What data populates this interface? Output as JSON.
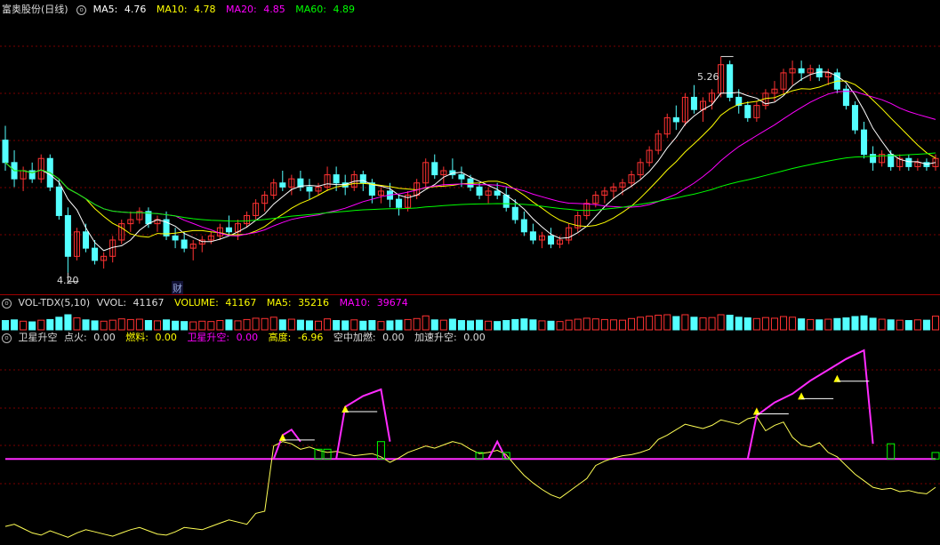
{
  "colors": {
    "up": "#ff3232",
    "down": "#54ffff",
    "ma5": "#ffffff",
    "ma10": "#ffff00",
    "ma20": "#ff00ff",
    "ma60": "#00ff00",
    "grid": "#7a0000",
    "magenta": "#ff2bff",
    "yellowLine": "#ffff55",
    "green": "#00ff00",
    "vol_up": "#ff3232",
    "vol_down": "#54ffff"
  },
  "price_panel": {
    "title": "富奥股份(日线)",
    "icon": "circle-icon",
    "ma5_label": "MA5:",
    "ma5_value": "4.76",
    "ma10_label": "MA10:",
    "ma10_value": "4.78",
    "ma20_label": "MA20:",
    "ma20_value": "4.85",
    "ma60_label": "MA60:",
    "ma60_value": "4.89",
    "high_label": "5.26",
    "low_label": "4.20",
    "marker_text": "财"
  },
  "vol_panel": {
    "title": "VOL-TDX(5,10)",
    "vvol_label": "VVOL:",
    "vvol_value": "41167",
    "volume_label": "VOLUME:",
    "volume_value": "41167",
    "ma5_label": "MA5:",
    "ma5_value": "35216",
    "ma10_label": "MA10:",
    "ma10_value": "39674"
  },
  "ind_panel": {
    "title": "卫星升空",
    "dianhuo_label": "点火:",
    "dianhuo_value": "0.00",
    "ranliao_label": "燃料:",
    "ranliao_value": "0.00",
    "weixing_label": "卫星升空:",
    "weixing_value": "0.00",
    "gaodu_label": "高度:",
    "gaodu_value": "-6.96",
    "kongzhong_label": "空中加燃:",
    "kongzhong_value": "0.00",
    "jiasu_label": "加速升空:",
    "jiasu_value": "0.00"
  },
  "chart_data": {
    "type": "candlestick",
    "price_range": [
      4.12,
      5.45
    ],
    "ma_names": [
      "MA5",
      "MA10",
      "MA20",
      "MA60"
    ],
    "candles": [
      [
        4.85,
        4.92,
        4.7,
        4.74
      ],
      [
        4.74,
        4.8,
        4.62,
        4.66
      ],
      [
        4.66,
        4.72,
        4.6,
        4.7
      ],
      [
        4.7,
        4.74,
        4.64,
        4.66
      ],
      [
        4.66,
        4.78,
        4.64,
        4.76
      ],
      [
        4.76,
        4.78,
        4.6,
        4.62
      ],
      [
        4.62,
        4.66,
        4.46,
        4.48
      ],
      [
        4.48,
        4.52,
        4.2,
        4.28
      ],
      [
        4.28,
        4.42,
        4.26,
        4.4
      ],
      [
        4.4,
        4.44,
        4.3,
        4.32
      ],
      [
        4.32,
        4.36,
        4.24,
        4.26
      ],
      [
        4.26,
        4.3,
        4.22,
        4.28
      ],
      [
        4.28,
        4.38,
        4.25,
        4.36
      ],
      [
        4.36,
        4.46,
        4.34,
        4.44
      ],
      [
        4.44,
        4.5,
        4.4,
        4.46
      ],
      [
        4.46,
        4.52,
        4.44,
        4.5
      ],
      [
        4.5,
        4.52,
        4.42,
        4.44
      ],
      [
        4.44,
        4.48,
        4.4,
        4.46
      ],
      [
        4.46,
        4.5,
        4.36,
        4.38
      ],
      [
        4.38,
        4.42,
        4.32,
        4.36
      ],
      [
        4.36,
        4.4,
        4.3,
        4.32
      ],
      [
        4.32,
        4.36,
        4.26,
        4.34
      ],
      [
        4.34,
        4.38,
        4.3,
        4.36
      ],
      [
        4.36,
        4.4,
        4.34,
        4.38
      ],
      [
        4.38,
        4.44,
        4.36,
        4.42
      ],
      [
        4.42,
        4.48,
        4.38,
        4.4
      ],
      [
        4.4,
        4.46,
        4.36,
        4.44
      ],
      [
        4.44,
        4.5,
        4.42,
        4.48
      ],
      [
        4.48,
        4.56,
        4.46,
        4.54
      ],
      [
        4.54,
        4.6,
        4.5,
        4.58
      ],
      [
        4.58,
        4.66,
        4.56,
        4.64
      ],
      [
        4.64,
        4.7,
        4.6,
        4.62
      ],
      [
        4.62,
        4.68,
        4.58,
        4.66
      ],
      [
        4.66,
        4.7,
        4.6,
        4.62
      ],
      [
        4.62,
        4.66,
        4.56,
        4.6
      ],
      [
        4.6,
        4.64,
        4.58,
        4.62
      ],
      [
        4.62,
        4.72,
        4.6,
        4.68
      ],
      [
        4.68,
        4.72,
        4.6,
        4.64
      ],
      [
        4.64,
        4.68,
        4.58,
        4.62
      ],
      [
        4.62,
        4.7,
        4.6,
        4.68
      ],
      [
        4.68,
        4.7,
        4.6,
        4.64
      ],
      [
        4.64,
        4.66,
        4.54,
        4.58
      ],
      [
        4.58,
        4.62,
        4.54,
        4.6
      ],
      [
        4.6,
        4.64,
        4.52,
        4.56
      ],
      [
        4.56,
        4.58,
        4.48,
        4.52
      ],
      [
        4.52,
        4.6,
        4.5,
        4.58
      ],
      [
        4.58,
        4.66,
        4.56,
        4.64
      ],
      [
        4.64,
        4.76,
        4.62,
        4.74
      ],
      [
        4.74,
        4.78,
        4.66,
        4.68
      ],
      [
        4.68,
        4.72,
        4.62,
        4.7
      ],
      [
        4.7,
        4.76,
        4.66,
        4.68
      ],
      [
        4.68,
        4.72,
        4.62,
        4.66
      ],
      [
        4.66,
        4.68,
        4.6,
        4.62
      ],
      [
        4.62,
        4.64,
        4.56,
        4.58
      ],
      [
        4.58,
        4.62,
        4.54,
        4.6
      ],
      [
        4.6,
        4.64,
        4.56,
        4.58
      ],
      [
        4.58,
        4.62,
        4.5,
        4.52
      ],
      [
        4.52,
        4.56,
        4.44,
        4.46
      ],
      [
        4.46,
        4.5,
        4.38,
        4.4
      ],
      [
        4.4,
        4.44,
        4.34,
        4.36
      ],
      [
        4.36,
        4.4,
        4.32,
        4.38
      ],
      [
        4.38,
        4.42,
        4.32,
        4.34
      ],
      [
        4.34,
        4.38,
        4.32,
        4.36
      ],
      [
        4.36,
        4.44,
        4.34,
        4.42
      ],
      [
        4.42,
        4.5,
        4.4,
        4.48
      ],
      [
        4.48,
        4.56,
        4.46,
        4.54
      ],
      [
        4.54,
        4.6,
        4.52,
        4.58
      ],
      [
        4.58,
        4.62,
        4.54,
        4.6
      ],
      [
        4.6,
        4.64,
        4.56,
        4.62
      ],
      [
        4.62,
        4.66,
        4.58,
        4.64
      ],
      [
        4.64,
        4.7,
        4.62,
        4.68
      ],
      [
        4.68,
        4.76,
        4.66,
        4.74
      ],
      [
        4.74,
        4.82,
        4.72,
        4.8
      ],
      [
        4.8,
        4.9,
        4.78,
        4.88
      ],
      [
        4.88,
        4.98,
        4.86,
        4.96
      ],
      [
        4.96,
        5.02,
        4.9,
        4.94
      ],
      [
        4.94,
        5.08,
        4.92,
        5.06
      ],
      [
        5.06,
        5.12,
        4.98,
        5.0
      ],
      [
        5.0,
        5.06,
        4.94,
        5.04
      ],
      [
        5.04,
        5.1,
        5.0,
        5.08
      ],
      [
        5.08,
        5.26,
        5.06,
        5.22
      ],
      [
        5.22,
        5.24,
        5.04,
        5.06
      ],
      [
        5.06,
        5.1,
        4.98,
        5.02
      ],
      [
        5.02,
        5.04,
        4.94,
        4.96
      ],
      [
        4.96,
        5.04,
        4.94,
        5.02
      ],
      [
        5.02,
        5.1,
        5.0,
        5.08
      ],
      [
        5.08,
        5.14,
        5.04,
        5.1
      ],
      [
        5.1,
        5.2,
        5.08,
        5.18
      ],
      [
        5.18,
        5.24,
        5.12,
        5.2
      ],
      [
        5.2,
        5.24,
        5.14,
        5.18
      ],
      [
        5.18,
        5.22,
        5.14,
        5.2
      ],
      [
        5.2,
        5.22,
        5.14,
        5.16
      ],
      [
        5.16,
        5.2,
        5.12,
        5.18
      ],
      [
        5.18,
        5.2,
        5.08,
        5.1
      ],
      [
        5.1,
        5.12,
        5.0,
        5.02
      ],
      [
        5.02,
        5.04,
        4.88,
        4.9
      ],
      [
        4.9,
        4.94,
        4.76,
        4.78
      ],
      [
        4.78,
        4.82,
        4.7,
        4.74
      ],
      [
        4.74,
        4.8,
        4.72,
        4.78
      ],
      [
        4.78,
        4.8,
        4.7,
        4.72
      ],
      [
        4.72,
        4.78,
        4.7,
        4.76
      ],
      [
        4.76,
        4.78,
        4.7,
        4.72
      ],
      [
        4.72,
        4.76,
        4.7,
        4.74
      ],
      [
        4.74,
        4.76,
        4.7,
        4.72
      ],
      [
        4.72,
        4.78,
        4.7,
        4.76
      ]
    ],
    "volume_range": [
      0,
      100000
    ],
    "volumes": [
      28000,
      30000,
      26000,
      24000,
      29000,
      31000,
      38000,
      52000,
      36000,
      30000,
      27000,
      26000,
      29000,
      33000,
      31000,
      32000,
      28000,
      27000,
      30000,
      26000,
      25000,
      24000,
      26000,
      25000,
      28000,
      30000,
      27000,
      31000,
      35000,
      34000,
      38000,
      30000,
      32000,
      29000,
      27000,
      26000,
      33000,
      28000,
      27000,
      30000,
      26000,
      28000,
      25000,
      27000,
      29000,
      31000,
      34000,
      42000,
      30000,
      29000,
      32000,
      28000,
      27000,
      29000,
      26000,
      25000,
      28000,
      31000,
      33000,
      30000,
      27000,
      26000,
      25000,
      29000,
      32000,
      35000,
      33000,
      31000,
      30000,
      29000,
      34000,
      38000,
      41000,
      44000,
      48000,
      40000,
      46000,
      38000,
      36000,
      37000,
      52000,
      44000,
      38000,
      36000,
      34000,
      37000,
      35000,
      40000,
      38000,
      33000,
      31000,
      30000,
      32000,
      34000,
      36000,
      40000,
      42000,
      35000,
      32000,
      30000,
      29000,
      28000,
      30000,
      29000,
      41167
    ],
    "indicator_range": [
      -7.5,
      10.0
    ],
    "height_line": [
      -6.2,
      -6.0,
      -6.4,
      -6.8,
      -7.0,
      -6.6,
      -6.9,
      -7.2,
      -6.8,
      -6.5,
      -6.7,
      -6.9,
      -7.1,
      -6.8,
      -6.5,
      -6.3,
      -6.6,
      -6.9,
      -7.0,
      -6.7,
      -6.3,
      -6.4,
      -6.5,
      -6.2,
      -5.9,
      -5.6,
      -5.8,
      -6.0,
      -5.0,
      -4.8,
      1.2,
      1.6,
      1.4,
      0.9,
      1.1,
      0.8,
      0.6,
      0.7,
      0.5,
      0.3,
      0.4,
      0.5,
      0.2,
      -0.3,
      0.1,
      0.6,
      0.9,
      1.2,
      1.0,
      1.3,
      1.6,
      1.4,
      0.9,
      0.5,
      0.6,
      0.8,
      0.4,
      -0.6,
      -1.5,
      -2.2,
      -2.8,
      -3.3,
      -3.6,
      -3.0,
      -2.4,
      -1.8,
      -0.6,
      -0.2,
      0.1,
      0.3,
      0.4,
      0.6,
      0.9,
      1.8,
      2.2,
      2.7,
      3.2,
      3.0,
      2.8,
      3.1,
      3.6,
      3.4,
      3.2,
      3.7,
      3.9,
      2.6,
      3.1,
      3.4,
      2.0,
      1.3,
      1.1,
      1.5,
      0.6,
      0.2,
      -0.6,
      -1.4,
      -2.0,
      -2.6,
      -2.8,
      -2.7,
      -3.0,
      -2.9,
      -3.1,
      -3.2,
      -2.6
    ],
    "signal_segments": [
      {
        "type": "magenta",
        "points": [
          [
            30,
            0
          ],
          [
            31,
            2.2
          ],
          [
            32,
            2.7
          ],
          [
            33,
            1.6
          ]
        ]
      },
      {
        "type": "magenta",
        "points": [
          [
            37,
            0
          ],
          [
            38,
            4.8
          ],
          [
            40,
            5.8
          ],
          [
            42,
            6.4
          ],
          [
            43,
            1.6
          ]
        ]
      },
      {
        "type": "magenta",
        "points": [
          [
            54,
            0
          ],
          [
            55,
            1.6
          ],
          [
            56,
            0
          ]
        ]
      },
      {
        "type": "magenta",
        "points": [
          [
            83,
            0
          ],
          [
            84,
            4.0
          ],
          [
            86,
            5.2
          ],
          [
            88,
            6.0
          ],
          [
            90,
            7.2
          ],
          [
            92,
            8.2
          ],
          [
            94,
            9.2
          ],
          [
            96,
            10.0
          ],
          [
            97,
            1.4
          ]
        ]
      },
      {
        "type": "magenta",
        "points": [
          [
            105,
            0
          ],
          [
            106,
            1.0
          ],
          [
            108,
            1.8
          ],
          [
            109,
            0.4
          ]
        ]
      }
    ],
    "triangles": [
      [
        31,
        2.0
      ],
      [
        38,
        4.6
      ],
      [
        84,
        4.4
      ],
      [
        89,
        5.8
      ],
      [
        93,
        7.4
      ]
    ],
    "green_boxes": [
      [
        35,
        0.9
      ],
      [
        36,
        0.9
      ],
      [
        42,
        1.6
      ],
      [
        53,
        0.6
      ],
      [
        56,
        0.6
      ],
      [
        99,
        1.4
      ],
      [
        104,
        0.6
      ],
      [
        108,
        0.8
      ],
      [
        110,
        0.8
      ]
    ]
  }
}
